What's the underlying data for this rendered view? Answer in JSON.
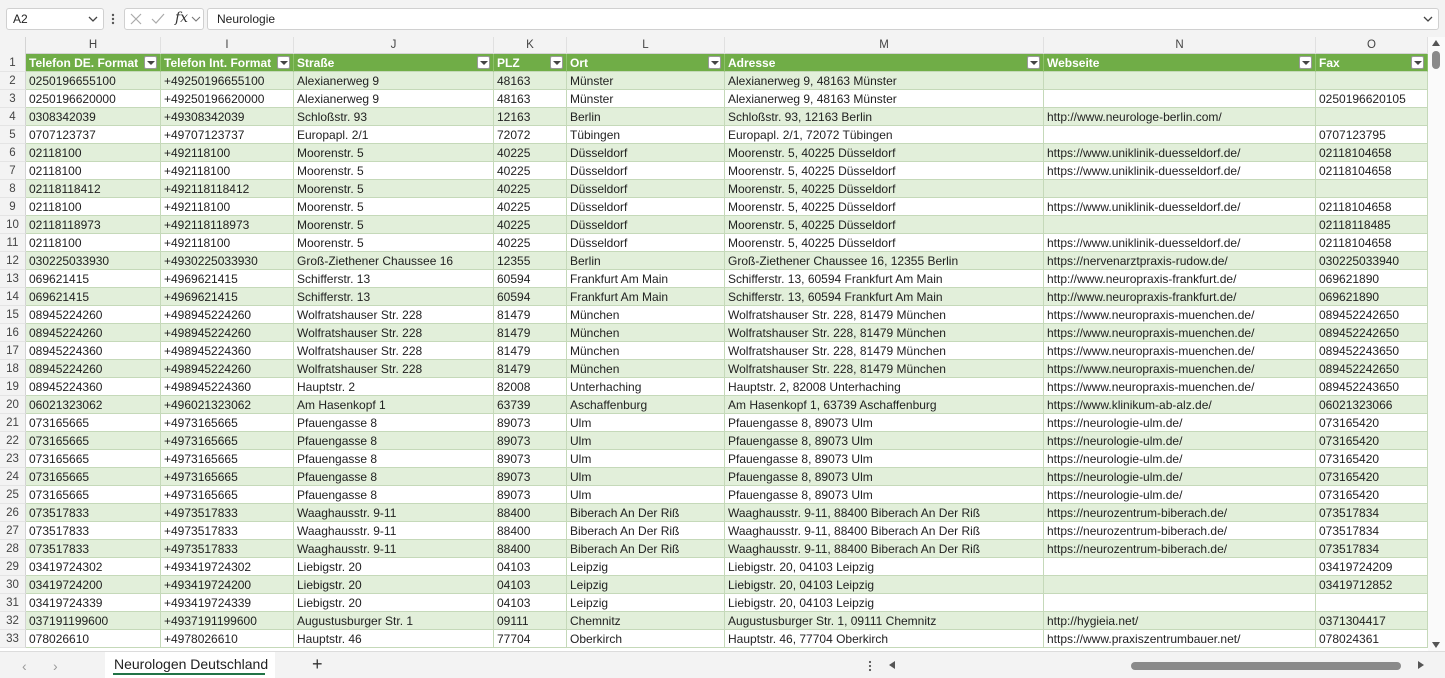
{
  "formula_bar": {
    "name_box": "A2",
    "fx_label": "fx",
    "formula": "Neurologie"
  },
  "columns": [
    "H",
    "I",
    "J",
    "K",
    "L",
    "M",
    "N",
    "O"
  ],
  "headers": [
    "Telefon DE. Format",
    "Telefon Int. Format",
    "Straße",
    "PLZ",
    "Ort",
    "Adresse",
    "Webseite",
    "Fax"
  ],
  "rows": [
    {
      "n": "2",
      "cells": [
        "0250196655100",
        "+49250196655100",
        "Alexianerweg 9",
        "48163",
        "Münster",
        "Alexianerweg 9, 48163 Münster",
        "",
        ""
      ]
    },
    {
      "n": "3",
      "cells": [
        "0250196620000",
        "+49250196620000",
        "Alexianerweg 9",
        "48163",
        "Münster",
        "Alexianerweg 9, 48163 Münster",
        "",
        "0250196620105"
      ]
    },
    {
      "n": "4",
      "cells": [
        "0308342039",
        "+49308342039",
        "Schloßstr. 93",
        "12163",
        "Berlin",
        "Schloßstr. 93, 12163 Berlin",
        "http://www.neurologe-berlin.com/",
        ""
      ]
    },
    {
      "n": "5",
      "cells": [
        "0707123737",
        "+49707123737",
        "Europapl. 2/1",
        "72072",
        "Tübingen",
        "Europapl. 2/1, 72072 Tübingen",
        "",
        "0707123795"
      ]
    },
    {
      "n": "6",
      "cells": [
        "02118100",
        "+492118100",
        "Moorenstr. 5",
        "40225",
        "Düsseldorf",
        "Moorenstr. 5, 40225 Düsseldorf",
        "https://www.uniklinik-duesseldorf.de/",
        "02118104658"
      ]
    },
    {
      "n": "7",
      "cells": [
        "02118100",
        "+492118100",
        "Moorenstr. 5",
        "40225",
        "Düsseldorf",
        "Moorenstr. 5, 40225 Düsseldorf",
        "https://www.uniklinik-duesseldorf.de/",
        "02118104658"
      ]
    },
    {
      "n": "8",
      "cells": [
        "02118118412",
        "+492118118412",
        "Moorenstr. 5",
        "40225",
        "Düsseldorf",
        "Moorenstr. 5, 40225 Düsseldorf",
        "",
        ""
      ]
    },
    {
      "n": "9",
      "cells": [
        "02118100",
        "+492118100",
        "Moorenstr. 5",
        "40225",
        "Düsseldorf",
        "Moorenstr. 5, 40225 Düsseldorf",
        "https://www.uniklinik-duesseldorf.de/",
        "02118104658"
      ]
    },
    {
      "n": "10",
      "cells": [
        "02118118973",
        "+492118118973",
        "Moorenstr. 5",
        "40225",
        "Düsseldorf",
        "Moorenstr. 5, 40225 Düsseldorf",
        "",
        "02118118485"
      ]
    },
    {
      "n": "11",
      "cells": [
        "02118100",
        "+492118100",
        "Moorenstr. 5",
        "40225",
        "Düsseldorf",
        "Moorenstr. 5, 40225 Düsseldorf",
        "https://www.uniklinik-duesseldorf.de/",
        "02118104658"
      ]
    },
    {
      "n": "12",
      "cells": [
        "030225033930",
        "+4930225033930",
        "Groß-Ziethener Chaussee 16",
        "12355",
        "Berlin",
        "Groß-Ziethener Chaussee 16, 12355 Berlin",
        "https://nervenarztpraxis-rudow.de/",
        "030225033940"
      ]
    },
    {
      "n": "13",
      "cells": [
        "069621415",
        "+4969621415",
        "Schifferstr. 13",
        "60594",
        "Frankfurt Am Main",
        "Schifferstr. 13, 60594 Frankfurt Am Main",
        "http://www.neuropraxis-frankfurt.de/",
        "069621890"
      ]
    },
    {
      "n": "14",
      "cells": [
        "069621415",
        "+4969621415",
        "Schifferstr. 13",
        "60594",
        "Frankfurt Am Main",
        "Schifferstr. 13, 60594 Frankfurt Am Main",
        "http://www.neuropraxis-frankfurt.de/",
        "069621890"
      ]
    },
    {
      "n": "15",
      "cells": [
        "08945224260",
        "+498945224260",
        "Wolfratshauser Str. 228",
        "81479",
        "München",
        "Wolfratshauser Str. 228, 81479 München",
        "https://www.neuropraxis-muenchen.de/",
        "089452242650"
      ]
    },
    {
      "n": "16",
      "cells": [
        "08945224260",
        "+498945224260",
        "Wolfratshauser Str. 228",
        "81479",
        "München",
        "Wolfratshauser Str. 228, 81479 München",
        "https://www.neuropraxis-muenchen.de/",
        "089452242650"
      ]
    },
    {
      "n": "17",
      "cells": [
        "08945224360",
        "+498945224360",
        "Wolfratshauser Str. 228",
        "81479",
        "München",
        "Wolfratshauser Str. 228, 81479 München",
        "https://www.neuropraxis-muenchen.de/",
        "089452243650"
      ]
    },
    {
      "n": "18",
      "cells": [
        "08945224260",
        "+498945224260",
        "Wolfratshauser Str. 228",
        "81479",
        "München",
        "Wolfratshauser Str. 228, 81479 München",
        "https://www.neuropraxis-muenchen.de/",
        "089452242650"
      ]
    },
    {
      "n": "19",
      "cells": [
        "08945224360",
        "+498945224360",
        "Hauptstr. 2",
        "82008",
        "Unterhaching",
        "Hauptstr. 2, 82008 Unterhaching",
        "https://www.neuropraxis-muenchen.de/",
        "089452243650"
      ]
    },
    {
      "n": "20",
      "cells": [
        "06021323062",
        "+496021323062",
        "Am Hasenkopf 1",
        "63739",
        "Aschaffenburg",
        "Am Hasenkopf 1, 63739 Aschaffenburg",
        "https://www.klinikum-ab-alz.de/",
        "06021323066"
      ]
    },
    {
      "n": "21",
      "cells": [
        "073165665",
        "+4973165665",
        "Pfauengasse 8",
        "89073",
        "Ulm",
        "Pfauengasse 8, 89073 Ulm",
        "https://neurologie-ulm.de/",
        "073165420"
      ]
    },
    {
      "n": "22",
      "cells": [
        "073165665",
        "+4973165665",
        "Pfauengasse 8",
        "89073",
        "Ulm",
        "Pfauengasse 8, 89073 Ulm",
        "https://neurologie-ulm.de/",
        "073165420"
      ]
    },
    {
      "n": "23",
      "cells": [
        "073165665",
        "+4973165665",
        "Pfauengasse 8",
        "89073",
        "Ulm",
        "Pfauengasse 8, 89073 Ulm",
        "https://neurologie-ulm.de/",
        "073165420"
      ]
    },
    {
      "n": "24",
      "cells": [
        "073165665",
        "+4973165665",
        "Pfauengasse 8",
        "89073",
        "Ulm",
        "Pfauengasse 8, 89073 Ulm",
        "https://neurologie-ulm.de/",
        "073165420"
      ]
    },
    {
      "n": "25",
      "cells": [
        "073165665",
        "+4973165665",
        "Pfauengasse 8",
        "89073",
        "Ulm",
        "Pfauengasse 8, 89073 Ulm",
        "https://neurologie-ulm.de/",
        "073165420"
      ]
    },
    {
      "n": "26",
      "cells": [
        "073517833",
        "+4973517833",
        "Waaghausstr. 9-11",
        "88400",
        "Biberach An Der Riß",
        "Waaghausstr. 9-11, 88400 Biberach An Der Riß",
        "https://neurozentrum-biberach.de/",
        "073517834"
      ]
    },
    {
      "n": "27",
      "cells": [
        "073517833",
        "+4973517833",
        "Waaghausstr. 9-11",
        "88400",
        "Biberach An Der Riß",
        "Waaghausstr. 9-11, 88400 Biberach An Der Riß",
        "https://neurozentrum-biberach.de/",
        "073517834"
      ]
    },
    {
      "n": "28",
      "cells": [
        "073517833",
        "+4973517833",
        "Waaghausstr. 9-11",
        "88400",
        "Biberach An Der Riß",
        "Waaghausstr. 9-11, 88400 Biberach An Der Riß",
        "https://neurozentrum-biberach.de/",
        "073517834"
      ]
    },
    {
      "n": "29",
      "cells": [
        "03419724302",
        "+493419724302",
        "Liebigstr. 20",
        "04103",
        "Leipzig",
        "Liebigstr. 20, 04103 Leipzig",
        "",
        "03419724209"
      ]
    },
    {
      "n": "30",
      "cells": [
        "03419724200",
        "+493419724200",
        "Liebigstr. 20",
        "04103",
        "Leipzig",
        "Liebigstr. 20, 04103 Leipzig",
        "",
        "03419712852"
      ]
    },
    {
      "n": "31",
      "cells": [
        "03419724339",
        "+493419724339",
        "Liebigstr. 20",
        "04103",
        "Leipzig",
        "Liebigstr. 20, 04103 Leipzig",
        "",
        ""
      ]
    },
    {
      "n": "32",
      "cells": [
        "037191199600",
        "+4937191199600",
        "Augustusburger Str. 1",
        "09111",
        "Chemnitz",
        "Augustusburger Str. 1, 09111 Chemnitz",
        "http://hygieia.net/",
        "0371304417"
      ]
    },
    {
      "n": "33",
      "cells": [
        "078026610",
        "+4978026610",
        "Hauptstr. 46",
        "77704",
        "Oberkirch",
        "Hauptstr. 46, 77704 Oberkirch",
        "https://www.praxiszentrumbauer.net/",
        "078024361"
      ]
    }
  ],
  "sheet_tab": "Neurologen Deutschland",
  "add_sheet_label": "+",
  "colors": {
    "header_green": "#70ad47",
    "band_green": "#e2efda",
    "tab_underline": "#217346"
  },
  "icons": [
    "chevron-down-icon",
    "more-vertical-icon",
    "cancel-x-icon",
    "confirm-check-icon",
    "fx-icon",
    "filter-dropdown-icon",
    "add-sheet-icon"
  ]
}
